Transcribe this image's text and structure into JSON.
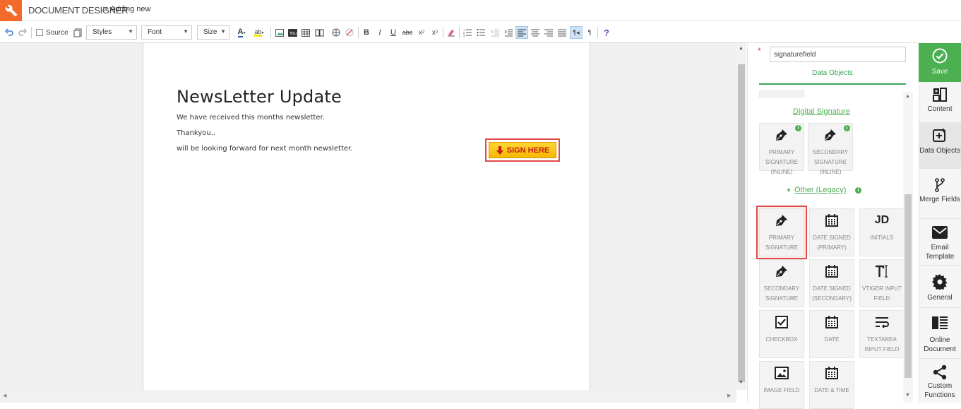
{
  "header": {
    "app_title": "DOCUMENT DESIGNER",
    "separator": ">",
    "breadcrumb": "Adding new"
  },
  "toolbar": {
    "source_label": "Source",
    "styles_label": "Styles",
    "font_label": "Font",
    "size_label": "Size",
    "help": "?"
  },
  "document": {
    "title": "NewsLetter Update",
    "lines": [
      "We have received this months newsletter.",
      "Thankyou..",
      "will be looking forward for next month newsletter."
    ],
    "sign_button": "SIGN HERE"
  },
  "panel": {
    "required_mark": "*",
    "field_name": "signaturefield",
    "tab_label": "Data Objects",
    "section_digital": "Digital Signature",
    "section_legacy": "Other (Legacy)",
    "digital_tiles": [
      {
        "label": "PRIMARY SIGNATURE (INLINE)",
        "icon": "pen-nib-icon"
      },
      {
        "label": "SECONDARY SIGNATURE (INLINE)",
        "icon": "pen-nib-icon"
      }
    ],
    "legacy_tiles": [
      {
        "label": "PRIMARY SIGNATURE",
        "icon": "pen-nib-icon"
      },
      {
        "label": "DATE SIGNED (PRIMARY)",
        "icon": "calendar-icon"
      },
      {
        "label": "INITIALS",
        "icon": "initials-icon",
        "glyph": "JD"
      },
      {
        "label": "SECONDARY SIGNATURE",
        "icon": "pen-nib-icon"
      },
      {
        "label": "DATE SIGNED (SECONDARY)",
        "icon": "calendar-icon"
      },
      {
        "label": "VTIGER INPUT FIELD",
        "icon": "text-field-icon"
      },
      {
        "label": "CHECKBOX",
        "icon": "checkbox-icon"
      },
      {
        "label": "DATE",
        "icon": "calendar-icon"
      },
      {
        "label": "TEXTAREA INPUT FIELD",
        "icon": "textarea-icon"
      },
      {
        "label": "IMAGE FIELD",
        "icon": "image-icon"
      },
      {
        "label": "DATE & TIME",
        "icon": "calendar-icon"
      }
    ]
  },
  "rail": {
    "save": "Save",
    "items": [
      {
        "label": "Content",
        "icon": "content-icon"
      },
      {
        "label": "Data Objects",
        "icon": "data-objects-icon"
      },
      {
        "label": "Merge Fields",
        "icon": "merge-icon"
      },
      {
        "label": "Email Template",
        "icon": "envelope-icon"
      },
      {
        "label": "General",
        "icon": "gear-icon"
      },
      {
        "label": "Online Document",
        "icon": "online-doc-icon"
      },
      {
        "label": "Custom Functions",
        "icon": "share-icon"
      }
    ]
  },
  "colors": {
    "brand": "#f26b2a",
    "accent": "#4caf50",
    "highlight": "#e24a4a"
  }
}
